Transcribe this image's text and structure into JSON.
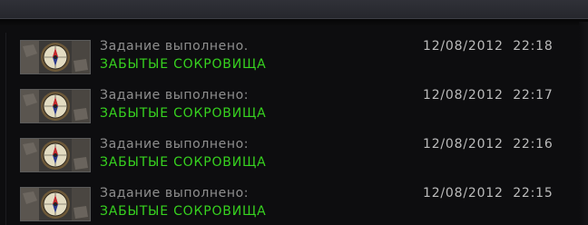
{
  "feed": {
    "entries": [
      {
        "icon": "compass-icon",
        "title": "Задание выполнено.",
        "quest": "ЗАБЫТЫЕ СОКРОВИЩА",
        "timestamp": "12/08/2012  22:18"
      },
      {
        "icon": "compass-icon",
        "title": "Задание выполнено:",
        "quest": "ЗАБЫТЫЕ СОКРОВИЩА",
        "timestamp": "12/08/2012  22:17"
      },
      {
        "icon": "compass-icon",
        "title": "Задание выполнено:",
        "quest": "ЗАБЫТЫЕ СОКРОВИЩА",
        "timestamp": "12/08/2012  22:16"
      },
      {
        "icon": "compass-icon",
        "title": "Задание выполнено:",
        "quest": "ЗАБЫТЫЕ СОКРОВИЩА",
        "timestamp": "12/08/2012  22:15"
      }
    ]
  },
  "colors": {
    "title_text": "#8f8f8f",
    "quest_text": "#37d21f",
    "timestamp_text": "#bcbcbc",
    "background": "#0d0d0f",
    "header_bar": "#2b2c32"
  }
}
